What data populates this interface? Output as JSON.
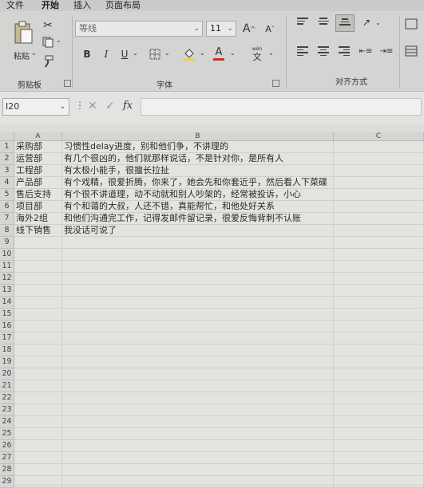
{
  "ribbon": {
    "tabs": [
      "文件",
      "开始",
      "插入",
      "页面布局"
    ],
    "active_tab": "开始",
    "clipboard": {
      "paste": "粘贴",
      "group": "剪贴板"
    },
    "font": {
      "name": "等线",
      "size": "11",
      "group": "字体",
      "bold": "B",
      "italic": "I",
      "underline": "U",
      "grow": "A",
      "shrink": "A",
      "color_letter": "A",
      "wen": "wén",
      "wen_char": "文"
    },
    "align": {
      "group": "对齐方式"
    }
  },
  "formula_bar": {
    "cell_ref": "I20",
    "fx": "fx",
    "value": ""
  },
  "sheet": {
    "columns": [
      "A",
      "B",
      "C"
    ],
    "rows": [
      {
        "n": "1",
        "a": "采购部",
        "b": "习惯性delay进度，别和他们争，不讲理的"
      },
      {
        "n": "2",
        "a": "运营部",
        "b": "有几个很凶的，他们就那样说话，不是针对你，是所有人"
      },
      {
        "n": "3",
        "a": "工程部",
        "b": "有太极小能手，很擅长拉扯"
      },
      {
        "n": "4",
        "a": "产品部",
        "b": "有个戏精，很爱折腾，你来了，她会先和你套近乎，然后看人下菜碟"
      },
      {
        "n": "5",
        "a": "售后支持",
        "b": "有个很不讲道理，动不动就和别人吵架的，经常被投诉，小心"
      },
      {
        "n": "6",
        "a": "项目部",
        "b": "有个和蔼的大叔，人还不错，真能帮忙，和他处好关系"
      },
      {
        "n": "7",
        "a": "海外2组",
        "b": "和他们沟通完工作，记得发邮件留记录，很爱反悔背刺不认账"
      },
      {
        "n": "8",
        "a": "线下销售",
        "b": "我没话可说了"
      },
      {
        "n": "9",
        "a": "",
        "b": ""
      },
      {
        "n": "10",
        "a": "",
        "b": ""
      },
      {
        "n": "11",
        "a": "",
        "b": ""
      },
      {
        "n": "12",
        "a": "",
        "b": ""
      },
      {
        "n": "13",
        "a": "",
        "b": ""
      },
      {
        "n": "14",
        "a": "",
        "b": ""
      },
      {
        "n": "15",
        "a": "",
        "b": ""
      },
      {
        "n": "16",
        "a": "",
        "b": ""
      },
      {
        "n": "17",
        "a": "",
        "b": ""
      },
      {
        "n": "18",
        "a": "",
        "b": ""
      },
      {
        "n": "19",
        "a": "",
        "b": ""
      },
      {
        "n": "20",
        "a": "",
        "b": ""
      },
      {
        "n": "21",
        "a": "",
        "b": ""
      },
      {
        "n": "22",
        "a": "",
        "b": ""
      },
      {
        "n": "23",
        "a": "",
        "b": ""
      },
      {
        "n": "24",
        "a": "",
        "b": ""
      },
      {
        "n": "25",
        "a": "",
        "b": ""
      },
      {
        "n": "26",
        "a": "",
        "b": ""
      },
      {
        "n": "27",
        "a": "",
        "b": ""
      },
      {
        "n": "28",
        "a": "",
        "b": ""
      },
      {
        "n": "29",
        "a": "",
        "b": ""
      }
    ]
  },
  "colors": {
    "accent": "#2f7d46",
    "font_color": "#d22b2b",
    "highlight": "#f1d33a"
  }
}
